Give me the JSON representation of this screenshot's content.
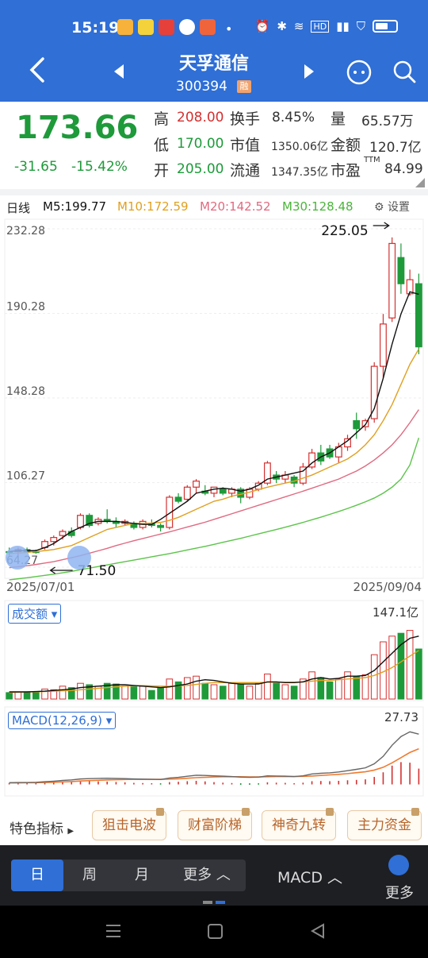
{
  "status": {
    "time": "15:19",
    "dot": "•"
  },
  "stock": {
    "name": "天孚通信",
    "code": "300394",
    "badge": "融"
  },
  "quote": {
    "price": "173.66",
    "change": "-31.65",
    "change_pct": "-15.42%",
    "high_label": "高",
    "high": "208.00",
    "low_label": "低",
    "low": "170.00",
    "open_label": "开",
    "open": "205.00",
    "turnover_label": "换手",
    "turnover": "8.45%",
    "mktcap_label": "市值",
    "mktcap": "1350.06亿",
    "float_label": "流通",
    "float": "1347.35亿",
    "volume_label": "量",
    "volume": "65.57万",
    "amount_label": "金额",
    "amount": "120.7亿",
    "pe_label": "市盈",
    "pe_sup": "TTM",
    "pe": "84.99"
  },
  "ma": {
    "period": "日线",
    "m5": "M5:199.77",
    "m10": "M10:172.59",
    "m20": "M20:142.52",
    "m30": "M30:128.48",
    "settings": "设置"
  },
  "colors": {
    "up": "#d43030",
    "down": "#1e9a3a",
    "m5": "#111111",
    "m10": "#e0a020",
    "m20": "#e06a80",
    "m30": "#5cc44a",
    "accent": "#2f6fd6"
  },
  "chart_data": {
    "type": "candlestick",
    "y_ticks": [
      "232.28",
      "190.28",
      "148.28",
      "106.27",
      "64.27"
    ],
    "x_labels": [
      "2025/07/01",
      "2025/09/04"
    ],
    "annotations": {
      "high": "225.05",
      "low": "71.50"
    },
    "candles": [
      [
        72,
        74,
        70,
        71.5
      ],
      [
        72,
        74,
        70,
        73
      ],
      [
        73,
        74,
        72,
        72
      ],
      [
        72,
        73,
        71,
        71.8
      ],
      [
        74,
        78,
        73,
        77
      ],
      [
        77,
        80,
        75,
        79
      ],
      [
        80,
        83,
        78,
        82
      ],
      [
        82,
        84,
        79,
        80
      ],
      [
        84,
        91,
        83,
        90
      ],
      [
        90,
        91,
        84,
        85
      ],
      [
        86,
        89,
        85,
        88
      ],
      [
        88,
        93,
        86,
        87
      ],
      [
        87,
        89,
        84,
        86
      ],
      [
        86,
        88,
        85,
        87
      ],
      [
        86,
        87,
        83,
        84
      ],
      [
        84,
        88,
        83,
        87
      ],
      [
        86,
        88,
        84,
        85
      ],
      [
        85,
        86,
        82,
        84
      ],
      [
        84,
        100,
        83,
        99
      ],
      [
        99,
        101,
        96,
        97
      ],
      [
        98,
        105,
        97,
        104
      ],
      [
        104,
        108,
        101,
        107
      ],
      [
        102,
        105,
        100,
        101
      ],
      [
        101,
        104,
        99,
        104
      ],
      [
        103,
        104,
        100,
        101
      ],
      [
        101,
        104,
        99,
        103
      ],
      [
        103,
        104,
        96,
        99
      ],
      [
        99,
        104,
        98,
        103
      ],
      [
        103,
        107,
        102,
        106
      ],
      [
        106,
        117,
        105,
        116
      ],
      [
        110,
        112,
        106,
        108
      ],
      [
        108,
        112,
        106,
        110
      ],
      [
        109,
        110,
        104,
        106
      ],
      [
        106,
        116,
        105,
        114
      ],
      [
        114,
        123,
        113,
        121
      ],
      [
        121,
        125,
        115,
        117
      ],
      [
        123,
        125,
        118,
        119
      ],
      [
        119,
        126,
        116,
        124
      ],
      [
        124,
        130,
        122,
        128
      ],
      [
        137,
        141,
        128,
        133
      ],
      [
        134,
        138,
        132,
        137
      ],
      [
        138,
        166,
        136,
        164
      ],
      [
        164,
        190,
        158,
        185
      ],
      [
        188,
        228,
        186,
        225
      ],
      [
        218,
        225,
        200,
        205
      ],
      [
        200,
        212,
        199,
        207
      ],
      [
        205,
        210,
        170,
        173.66
      ]
    ],
    "ma5": [
      72,
      72.5,
      72.4,
      72.5,
      74,
      76,
      79,
      82,
      84,
      86,
      87,
      87,
      87,
      86.5,
      86,
      85.5,
      85.5,
      88,
      91,
      94,
      97,
      101,
      102,
      103,
      103.5,
      103,
      102,
      103,
      105,
      108,
      109,
      110,
      111,
      112,
      116,
      119,
      121,
      124,
      127,
      131,
      135,
      143,
      158,
      175,
      190,
      201,
      199.77
    ],
    "ma10": [
      71,
      71.3,
      71.6,
      72,
      72.5,
      73,
      74,
      75,
      77,
      79,
      81,
      83,
      84,
      85,
      86,
      86,
      86.2,
      86.5,
      87.5,
      89,
      91,
      93,
      95,
      97,
      98,
      99.5,
      100.5,
      101.5,
      102.8,
      104,
      105,
      106,
      107,
      108.5,
      110,
      112,
      114,
      116,
      118,
      121,
      125,
      130,
      137,
      145,
      155,
      165,
      172.59
    ],
    "ma20": [
      64,
      64.5,
      65,
      65.6,
      66.3,
      67,
      68,
      69,
      70,
      71.2,
      72.4,
      73.6,
      75,
      76.2,
      77.4,
      78.5,
      79.6,
      80.7,
      81.8,
      83,
      84.2,
      85.4,
      86.6,
      88,
      89.4,
      90.8,
      92.2,
      93.6,
      95,
      96.4,
      97.8,
      99.2,
      100.6,
      102,
      103.5,
      105,
      106.5,
      108,
      110,
      112,
      114.5,
      117.5,
      121,
      125,
      130,
      136,
      142.52
    ],
    "ma30": [
      58,
      58.5,
      59,
      59.6,
      60.2,
      60.8,
      61.5,
      62.2,
      63,
      63.8,
      64.6,
      65.4,
      66.2,
      67,
      67.8,
      68.6,
      69.4,
      70.2,
      71,
      71.9,
      72.8,
      73.7,
      74.6,
      75.6,
      76.6,
      77.6,
      78.6,
      79.7,
      80.8,
      81.9,
      83,
      84.1,
      85.3,
      86.5,
      87.8,
      89.1,
      90.5,
      91.9,
      93.4,
      95,
      96.7,
      98.6,
      101,
      104,
      108,
      115,
      128.48
    ],
    "volume": {
      "max_label": "147.1亿",
      "selector": "成交额",
      "values": [
        9,
        10,
        9,
        10,
        14,
        13,
        18,
        16,
        22,
        20,
        18,
        22,
        21,
        18,
        17,
        18,
        12,
        15,
        28,
        24,
        30,
        32,
        22,
        20,
        18,
        22,
        21,
        18,
        22,
        35,
        22,
        20,
        18,
        28,
        38,
        30,
        24,
        28,
        38,
        32,
        34,
        62,
        80,
        88,
        92,
        96,
        70
      ],
      "ma5": [
        10,
        10,
        10,
        10.5,
        11,
        12,
        13,
        14,
        16,
        17,
        18,
        19,
        20,
        20,
        19,
        18,
        17,
        16,
        17,
        19,
        21,
        25,
        27,
        26,
        24,
        22,
        21,
        21,
        21,
        24,
        24,
        23,
        23,
        24,
        28,
        30,
        28,
        29,
        32,
        32,
        33,
        40,
        52,
        64,
        76,
        85,
        88
      ],
      "ma10": [
        9,
        9.5,
        10,
        10,
        10.5,
        11,
        11.5,
        12,
        13,
        14,
        15,
        16,
        17,
        18,
        18.5,
        18.8,
        18.4,
        18,
        18,
        18.5,
        19,
        20.5,
        22,
        23,
        23,
        23,
        23,
        23,
        23,
        23.5,
        23.5,
        23.5,
        23.5,
        24,
        25,
        26,
        26,
        27,
        28,
        29,
        30,
        33,
        38,
        44,
        52,
        60,
        68
      ]
    },
    "macd": {
      "selector": "MACD(12,26,9)",
      "max_label": "27.73",
      "dif": [
        0.3,
        0.4,
        0.4,
        0.5,
        0.8,
        1.1,
        1.5,
        1.8,
        2.3,
        2.5,
        2.6,
        2.7,
        2.6,
        2.5,
        2.3,
        2.2,
        2.1,
        2.0,
        2.8,
        3.2,
        3.8,
        4.3,
        4.2,
        4.0,
        3.8,
        3.6,
        3.3,
        3.2,
        3.3,
        4.0,
        3.9,
        3.8,
        3.6,
        4.0,
        5.0,
        5.4,
        5.6,
        6.1,
        6.8,
        7.5,
        8.3,
        10.5,
        14.5,
        20.5,
        25.2,
        27.73,
        26.5
      ],
      "dea": [
        0.2,
        0.2,
        0.3,
        0.3,
        0.4,
        0.5,
        0.7,
        0.9,
        1.2,
        1.4,
        1.6,
        1.8,
        1.9,
        2.0,
        2.1,
        2.1,
        2.1,
        2.1,
        2.2,
        2.4,
        2.7,
        3.0,
        3.2,
        3.4,
        3.5,
        3.5,
        3.5,
        3.4,
        3.4,
        3.5,
        3.6,
        3.6,
        3.6,
        3.7,
        3.9,
        4.2,
        4.5,
        4.8,
        5.2,
        5.7,
        6.2,
        7.1,
        8.6,
        11.0,
        13.8,
        16.6,
        18.6
      ],
      "hist": [
        0.1,
        0.2,
        0.1,
        0.2,
        0.4,
        0.6,
        0.8,
        0.9,
        1.1,
        1.1,
        1.0,
        0.9,
        0.7,
        0.5,
        0.2,
        0.1,
        0.0,
        -0.1,
        0.6,
        0.8,
        1.1,
        1.3,
        1.0,
        0.6,
        0.3,
        0.1,
        -0.2,
        -0.2,
        -0.1,
        0.5,
        0.3,
        0.2,
        0.0,
        0.3,
        1.1,
        1.2,
        1.1,
        1.3,
        1.6,
        1.8,
        2.1,
        3.4,
        5.9,
        9.5,
        11.4,
        11.1,
        7.9
      ]
    }
  },
  "special": {
    "label": "特色指标",
    "items": [
      "狙击电波",
      "财富阶梯",
      "神奇九转",
      "主力资金"
    ]
  },
  "bottom": {
    "periods": [
      "日",
      "周",
      "月",
      "更多"
    ],
    "indicator": "MACD",
    "more": "更多"
  }
}
